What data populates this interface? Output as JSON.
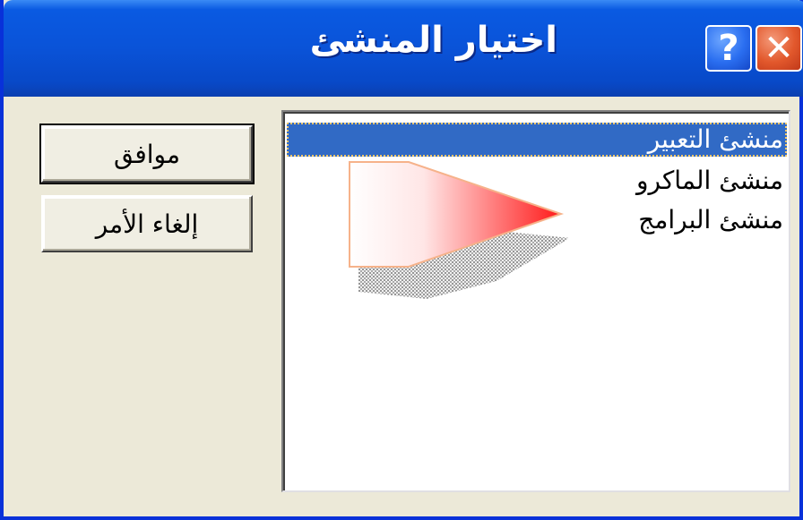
{
  "dialog": {
    "title": "اختيار المنشئ",
    "help_label": "?",
    "close_label": "✕"
  },
  "buttons": {
    "ok_label": "موافق",
    "cancel_label": "إلغاء الأمر"
  },
  "builders": {
    "selected_index": 0,
    "items": [
      {
        "label": "منشئ التعبير"
      },
      {
        "label": "منشئ الماكرو"
      },
      {
        "label": "منشئ البرامج"
      }
    ]
  },
  "colors": {
    "titlebar": "#0a53d8",
    "selection": "#316ac5",
    "dialog_bg": "#ece9d8",
    "pointer": "#ff2a2a"
  },
  "icons": [
    "help-icon",
    "close-icon",
    "pointer-arrow"
  ]
}
